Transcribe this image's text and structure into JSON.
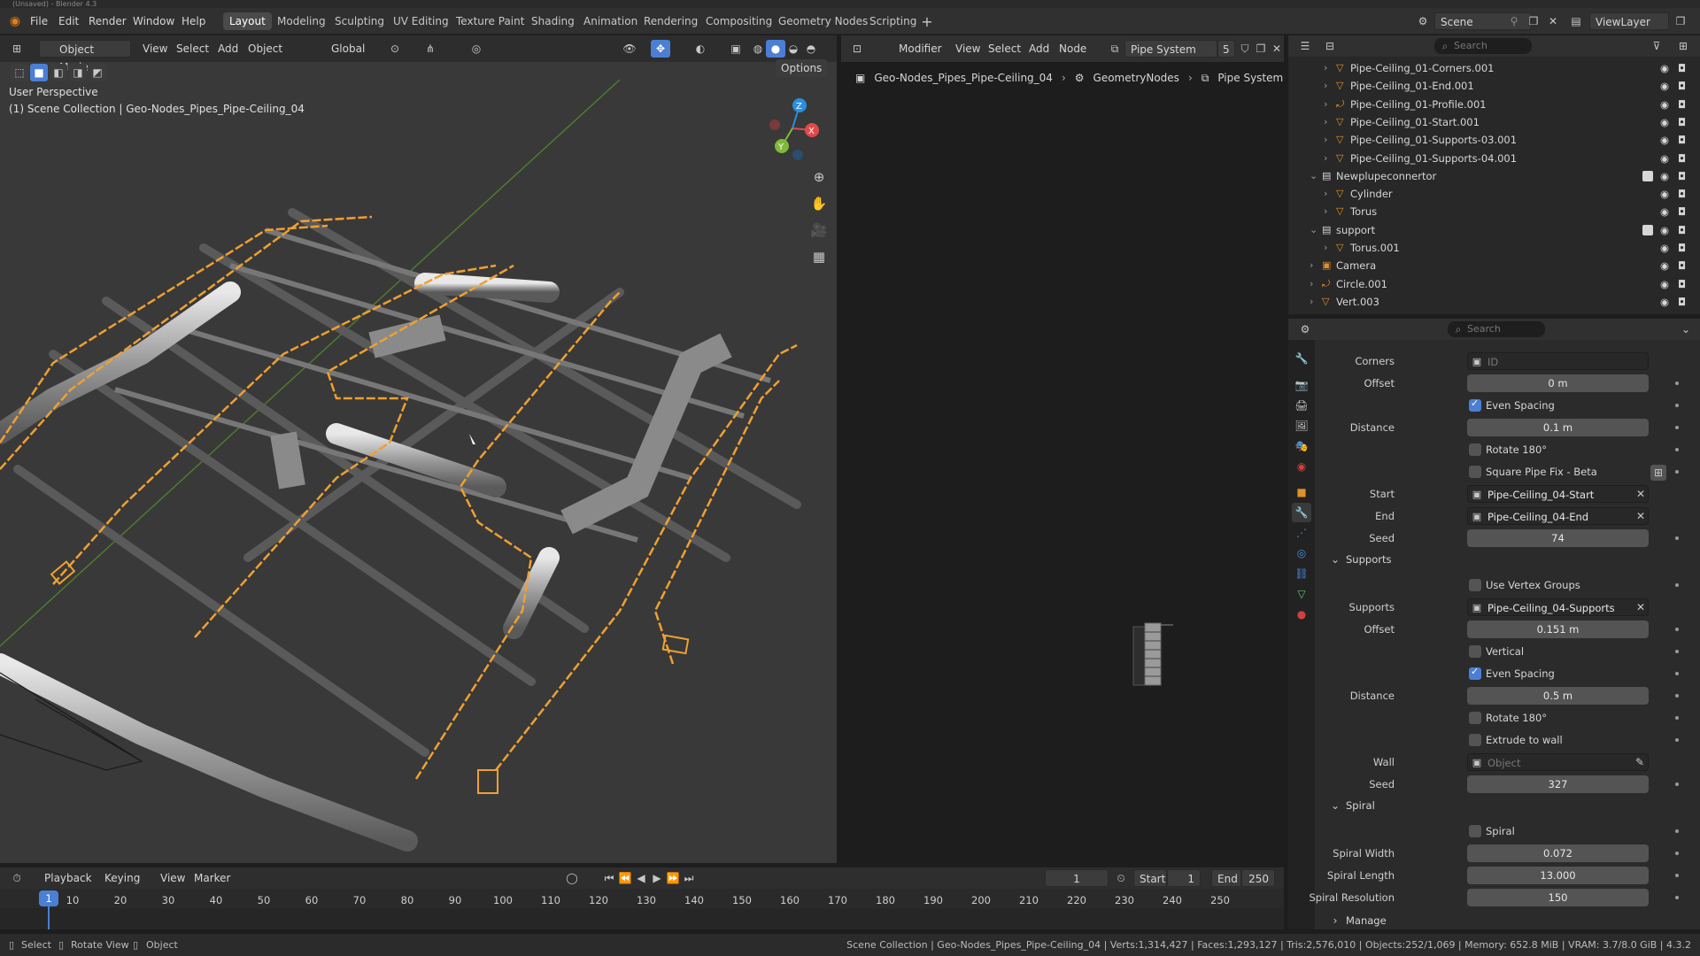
{
  "window": {
    "title": "(Unsaved) - Blender 4.3"
  },
  "menu": [
    "File",
    "Edit",
    "Render",
    "Window",
    "Help"
  ],
  "workspaces": [
    "Layout",
    "Modeling",
    "Sculpting",
    "UV Editing",
    "Texture Paint",
    "Shading",
    "Animation",
    "Rendering",
    "Compositing",
    "Geometry Nodes",
    "Scripting"
  ],
  "active_workspace": "Layout",
  "scene": {
    "name": "Scene",
    "view_layer": "ViewLayer"
  },
  "viewport": {
    "mode": "Object Mode",
    "menu": [
      "View",
      "Select",
      "Add",
      "Object"
    ],
    "transform": "Global",
    "options": "Options",
    "overlay_title": "User Perspective",
    "overlay_subtitle": "(1) Scene Collection | Geo-Nodes_Pipes_Pipe-Ceiling_04",
    "gizmo": {
      "x": "X",
      "y": "Y",
      "z": "Z"
    }
  },
  "node_editor": {
    "type": "Modifier",
    "menu": [
      "View",
      "Select",
      "Add",
      "Node"
    ],
    "tree": "Pipe System",
    "users": "5",
    "breadcrumb": [
      "Geo-Nodes_Pipes_Pipe-Ceiling_04",
      "GeometryNodes",
      "Pipe System"
    ]
  },
  "outliner": {
    "search_placeholder": "Search",
    "rows": [
      {
        "name": "Pipe-Ceiling_01-Corners.001",
        "indent": 2,
        "type": "mesh"
      },
      {
        "name": "Pipe-Ceiling_01-End.001",
        "indent": 2,
        "type": "mesh"
      },
      {
        "name": "Pipe-Ceiling_01-Profile.001",
        "indent": 2,
        "type": "curve"
      },
      {
        "name": "Pipe-Ceiling_01-Start.001",
        "indent": 2,
        "type": "mesh"
      },
      {
        "name": "Pipe-Ceiling_01-Supports-03.001",
        "indent": 2,
        "type": "mesh"
      },
      {
        "name": "Pipe-Ceiling_01-Supports-04.001",
        "indent": 2,
        "type": "mesh"
      },
      {
        "name": "Newplupeconnertor",
        "indent": 1,
        "type": "collection"
      },
      {
        "name": "Cylinder",
        "indent": 2,
        "type": "mesh"
      },
      {
        "name": "Torus",
        "indent": 2,
        "type": "mesh"
      },
      {
        "name": "support",
        "indent": 1,
        "type": "collection"
      },
      {
        "name": "Torus.001",
        "indent": 2,
        "type": "mesh"
      },
      {
        "name": "Camera",
        "indent": 1,
        "type": "camera"
      },
      {
        "name": "Circle.001",
        "indent": 1,
        "type": "curve"
      },
      {
        "name": "Vert.003",
        "indent": 1,
        "type": "mesh"
      }
    ]
  },
  "properties": {
    "search_placeholder": "Search",
    "corners": {
      "label": "Corners",
      "value": "ID"
    },
    "offset1": {
      "label": "Offset",
      "value": "0 m"
    },
    "even_spacing1": {
      "label": "Even Spacing",
      "checked": true
    },
    "distance1": {
      "label": "Distance",
      "value": "0.1 m"
    },
    "rotate1": {
      "label": "Rotate 180°",
      "checked": false
    },
    "square_fix": {
      "label": "Square Pipe Fix - Beta",
      "checked": false
    },
    "start": {
      "label": "Start",
      "value": "Pipe-Ceiling_04-Start"
    },
    "end": {
      "label": "End",
      "value": "Pipe-Ceiling_04-End"
    },
    "seed1": {
      "label": "Seed",
      "value": "74"
    },
    "supports_section": "Supports",
    "use_vgroups": {
      "label": "Use Vertex Groups",
      "checked": false
    },
    "supports": {
      "label": "Supports",
      "value": "Pipe-Ceiling_04-Supports"
    },
    "offset2": {
      "label": "Offset",
      "value": "0.151 m"
    },
    "vertical": {
      "label": "Vertical",
      "checked": false
    },
    "even_spacing2": {
      "label": "Even Spacing",
      "checked": true
    },
    "distance2": {
      "label": "Distance",
      "value": "0.5 m"
    },
    "rotate2": {
      "label": "Rotate 180°",
      "checked": false
    },
    "extrude": {
      "label": "Extrude to wall",
      "checked": false
    },
    "wall": {
      "label": "Wall",
      "placeholder": "Object"
    },
    "seed2": {
      "label": "Seed",
      "value": "327"
    },
    "spiral_section": "Spiral",
    "spiral": {
      "label": "Spiral",
      "checked": false
    },
    "spiral_width": {
      "label": "Spiral Width",
      "value": "0.072"
    },
    "spiral_length": {
      "label": "Spiral Length",
      "value": "13.000"
    },
    "spiral_res": {
      "label": "Spiral Resolution",
      "value": "150"
    },
    "manage_section": "Manage"
  },
  "timeline": {
    "menu": [
      "Playback",
      "Keying",
      "View",
      "Marker"
    ],
    "current_frame": "1",
    "start_label": "Start",
    "start": "1",
    "end_label": "End",
    "end": "250",
    "ticks": [
      "10",
      "20",
      "30",
      "40",
      "50",
      "60",
      "70",
      "80",
      "90",
      "100",
      "110",
      "120",
      "130",
      "140",
      "150",
      "160",
      "170",
      "180",
      "190",
      "200",
      "210",
      "220",
      "230",
      "240",
      "250"
    ]
  },
  "status": {
    "left": [
      "Select",
      "Rotate View",
      "Object"
    ],
    "right": "Scene Collection | Geo-Nodes_Pipes_Pipe-Ceiling_04 | Verts:1,314,427 | Faces:1,293,127 | Tris:2,576,010 | Objects:252/1,069 | Memory: 652.8 MiB | VRAM: 3.7/8.0 GiB | 4.3.2"
  },
  "colors": {
    "accent": "#4a7fd4",
    "selection": "#f0a030",
    "bg": "#1d1d1d"
  }
}
